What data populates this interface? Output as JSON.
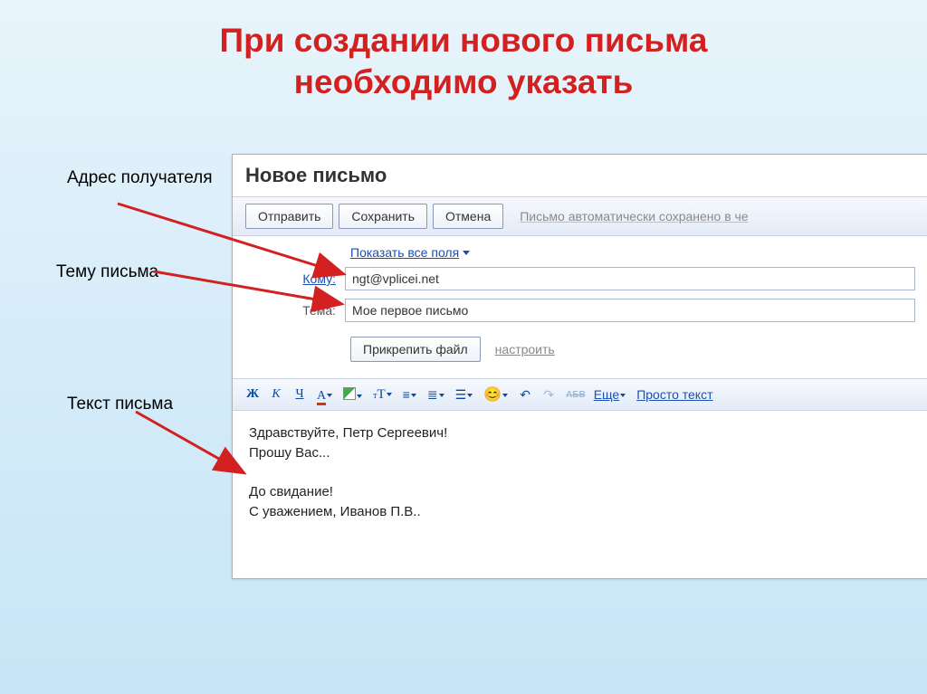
{
  "slide_title_line1": "При создании нового письма",
  "slide_title_line2": "необходимо указать",
  "labels": {
    "recipient": "Адрес получателя",
    "subject": "Тему письма",
    "body": "Текст письма"
  },
  "compose": {
    "window_title": "Новое письмо",
    "buttons": {
      "send": "Отправить",
      "save": "Сохранить",
      "cancel": "Отмена"
    },
    "autosave_hint": "Письмо автоматически сохранено в че",
    "show_all_fields": "Показать все поля",
    "to_label": "Кому:",
    "to_value": "ngt@vplicei.net",
    "subject_label": "Тема:",
    "subject_value": "Мое первое письмо",
    "attach_label": "Прикрепить файл",
    "configure": "настроить",
    "formatting": {
      "bold": "Ж",
      "italic": "К",
      "underline": "Ч",
      "color": "А",
      "more": "Еще",
      "plain_text": "Просто текст",
      "strike_label": "АБВ"
    },
    "body_text": "Здравствуйте, Петр Сергеевич!\nПрошу Вас...\n\nДо свидание!\nС уважением, Иванов П.В.."
  }
}
